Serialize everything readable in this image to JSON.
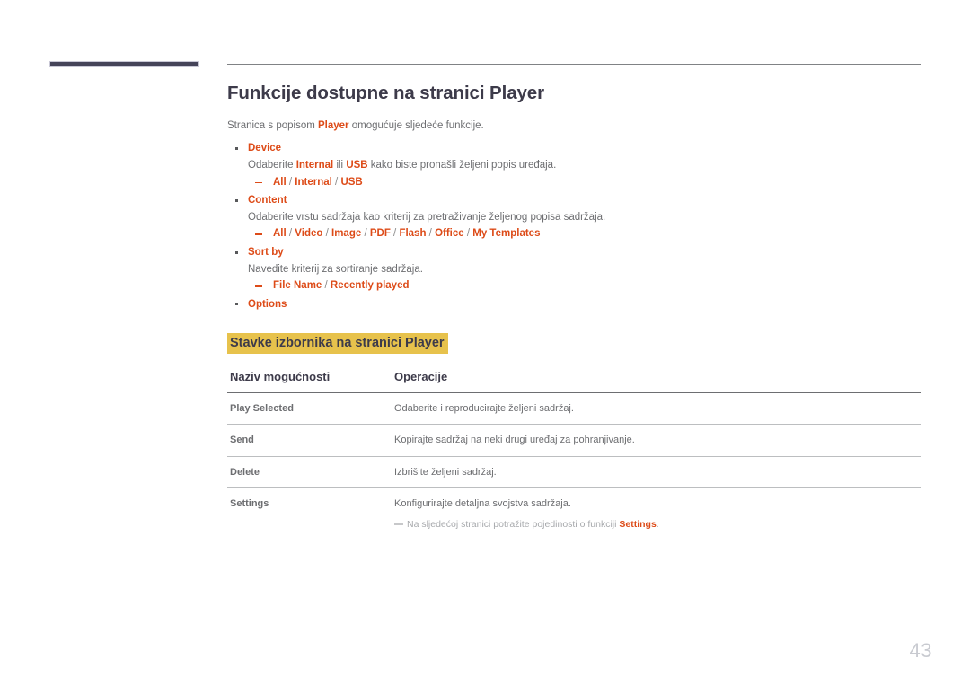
{
  "decoration": {
    "bar_color": "#454459",
    "rule_color": "#808285"
  },
  "accent_color": "#dd4b18",
  "highlight_color": "#e7c24c",
  "title": "Funkcije dostupne na stranici Player",
  "intro": {
    "before": "Stranica s popisom ",
    "bold": "Player",
    "after": " omogućuje sljedeće funkcije."
  },
  "features": [
    {
      "name": "Device",
      "desc_before": "Odaberite ",
      "desc_bold1": "Internal",
      "desc_mid": " ili ",
      "desc_bold2": "USB",
      "desc_after": " kako biste pronašli željeni popis uređaja.",
      "options": [
        "All",
        "Internal",
        "USB"
      ]
    },
    {
      "name": "Content",
      "desc": "Odaberite vrstu sadržaja kao kriterij za pretraživanje željenog popisa sadržaja.",
      "options": [
        "All",
        "Video",
        "Image",
        "PDF",
        "Flash",
        "Office",
        "My Templates"
      ]
    },
    {
      "name": "Sort by",
      "desc": "Navedite kriterij za sortiranje sadržaja.",
      "options": [
        "File Name",
        "Recently played"
      ]
    },
    {
      "name": "Options",
      "desc": "",
      "options": []
    }
  ],
  "section_heading": "Stavke izbornika na stranici Player",
  "table": {
    "headers": [
      "Naziv mogućnosti",
      "Operacije"
    ],
    "rows": [
      {
        "name": "Play Selected",
        "operation": "Odaberite i reproducirajte željeni sadržaj."
      },
      {
        "name": "Send",
        "operation": "Kopirajte sadržaj na neki drugi uređaj za pohranjivanje."
      },
      {
        "name": "Delete",
        "operation": "Izbrišite željeni sadržaj."
      },
      {
        "name": "Settings",
        "operation": "Konfigurirajte detaljna svojstva sadržaja.",
        "note_before": "Na sljedećoj stranici potražite pojedinosti o funkciji ",
        "note_bold": "Settings",
        "note_after": "."
      }
    ]
  },
  "page_number": "43"
}
